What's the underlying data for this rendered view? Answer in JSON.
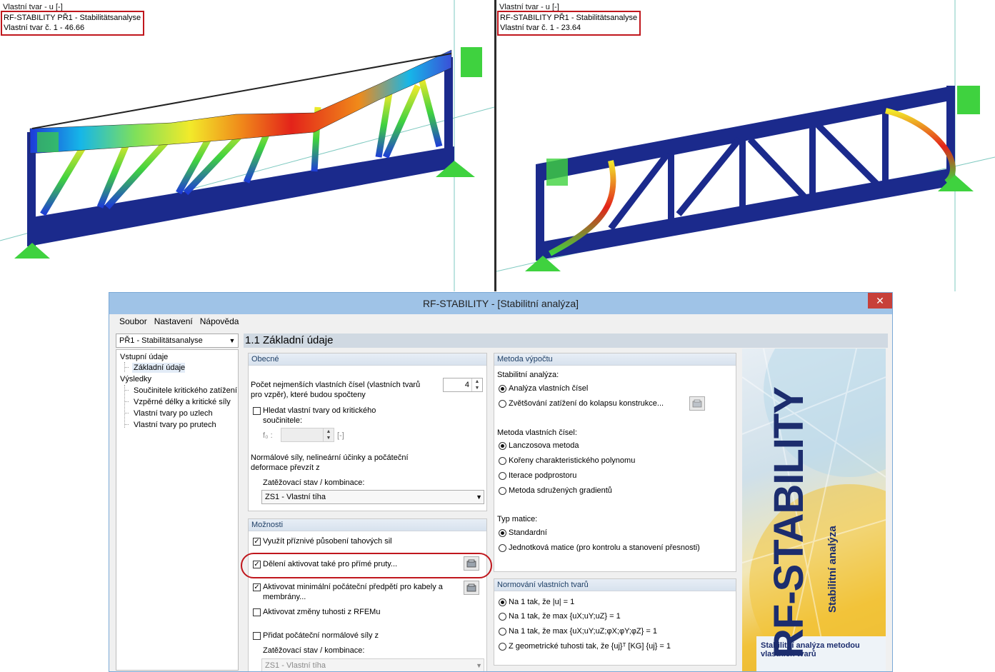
{
  "viewports": [
    {
      "header": "Vlastní tvar - u [-]",
      "line1": "RF-STABILITY PŘ1 - Stabilitätsanalyse",
      "line2": "Vlastní tvar č. 1  -  46.66"
    },
    {
      "header": "Vlastní tvar - u [-]",
      "line1": "RF-STABILITY PŘ1 - Stabilitätsanalyse",
      "line2": "Vlastní tvar č. 1  -  23.64"
    }
  ],
  "dialog": {
    "title": "RF-STABILITY - [Stabilitní analýza]",
    "close_glyph": "✕",
    "menu": [
      "Soubor",
      "Nastavení",
      "Nápověda"
    ],
    "case_select": "PŘ1 - Stabilitätsanalyse",
    "tree": {
      "input_root": "Vstupní údaje",
      "input_items": [
        "Základní údaje"
      ],
      "results_root": "Výsledky",
      "results_items": [
        "Součinitele kritického zatížení",
        "Vzpěrné délky a kritické síly",
        "Vlastní tvary po uzlech",
        "Vlastní tvary po prutech"
      ]
    },
    "page_title": "1.1 Základní údaje",
    "general": {
      "title": "Obecné",
      "eigen_count_label": "Počet nejmenších vlastních čísel (vlastních tvarů pro vzpěr), které budou spočteny",
      "eigen_count_value": "4",
      "find_shapes_label": "Hledat vlastní tvary od kritického součinitele:",
      "f0_label": "f₀ :",
      "f0_unit": "[-]",
      "normal_forces_label": "Normálové síly, nelineární účinky a počáteční deformace převzít z",
      "loadcase_label": "Zatěžovací stav / kombinace:",
      "loadcase_value": "ZS1 - Vlastní tíha"
    },
    "options": {
      "title": "Možnosti",
      "opt1": "Využít příznivé působení tahových sil",
      "opt2": "Dělení aktivovat také pro přímé pruty...",
      "opt3": "Aktivovat minimální počáteční předpětí pro kabely a membrány...",
      "opt4": "Aktivovat změny tuhosti z RFEMu",
      "opt5": "Přidat počáteční normálové síly z",
      "loadcase_label": "Zatěžovací stav / kombinace:",
      "loadcase_value": "ZS1 - Vlastní tíha"
    },
    "method": {
      "title": "Metoda výpočtu",
      "stability_label": "Stabilitní analýza:",
      "stability_opts": [
        "Analýza vlastních čísel",
        "Zvětšování zatížení do kolapsu konstrukce..."
      ],
      "eigen_method_label": "Metoda vlastních čísel:",
      "eigen_method_opts": [
        "Lanczosova metoda",
        "Kořeny charakteristického polynomu",
        "Iterace podprostoru",
        "Metoda sdružených gradientů"
      ],
      "matrix_label": "Typ matice:",
      "matrix_opts": [
        "Standardní",
        "Jednotková matice (pro kontrolu a stanovení přesnosti)"
      ]
    },
    "normalization": {
      "title": "Normování vlastních tvarů",
      "opts": [
        "Na 1 tak, že |u| = 1",
        "Na 1 tak, že max {uX;uY;uZ} = 1",
        "Na 1 tak, že max {uX;uY;uZ;φX;φY;φZ} = 1",
        "Z geometrické tuhosti tak, že {uj}ᵀ [KG] {uj} = 1"
      ]
    },
    "banner": {
      "title": "RF-STABILITY",
      "subtitle": "Stabilitní analýza",
      "caption": "Stabilitní analýza metodou vlastních tvarů"
    }
  },
  "colors": {
    "highlight": "#c0171d",
    "steel": "#1b2a8c",
    "support": "#3fd23f",
    "titlebar": "#9fc3e7"
  }
}
